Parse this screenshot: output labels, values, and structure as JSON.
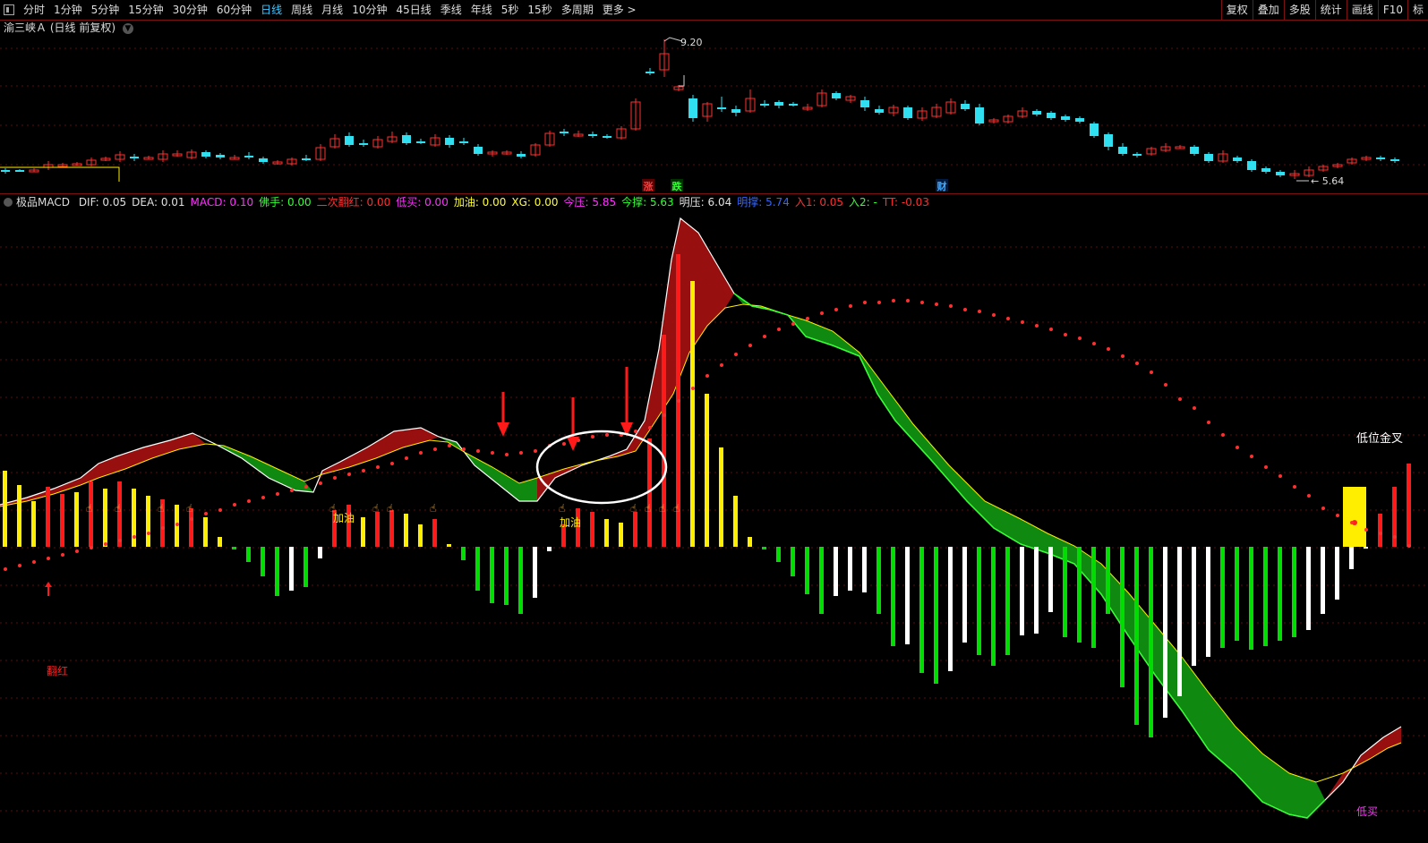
{
  "toolbar": {
    "periods": [
      "分时",
      "1分钟",
      "5分钟",
      "15分钟",
      "30分钟",
      "60分钟",
      "日线",
      "周线",
      "月线",
      "10分钟",
      "45日线",
      "季线",
      "年线",
      "5秒",
      "15秒",
      "多周期",
      "更多 >"
    ],
    "active_index": 6,
    "right_buttons": [
      "复权",
      "叠加",
      "多股",
      "统计",
      "画线",
      "F10",
      "标"
    ]
  },
  "stock": {
    "name": "渝三峡Ａ",
    "mode": "(日线 前复权)"
  },
  "price_chart": {
    "high_label": "9.20",
    "low_label": "5.64",
    "markers": [
      {
        "text": "涨",
        "color": "#ff3b3b",
        "bg": "#5a0000"
      },
      {
        "text": "跌",
        "color": "#33ff33",
        "bg": "#003300"
      },
      {
        "text": "财",
        "color": "#3fa9ff",
        "bg": "#001a40"
      }
    ],
    "colors": {
      "up": "#ff3030",
      "down": "#30e0f0",
      "grid": "#5a0c0c"
    }
  },
  "indicator": {
    "name": "极品MACD",
    "legend": [
      {
        "label": "DIF:",
        "value": "0.05",
        "color": "#e0e0e0"
      },
      {
        "label": "DEA:",
        "value": "0.01",
        "color": "#e0e0e0"
      },
      {
        "label": "MACD:",
        "value": "0.10",
        "color": "#ff33ff"
      },
      {
        "label": "佛手:",
        "value": "0.00",
        "color": "#33ff33"
      },
      {
        "label": "二次翻红:",
        "value": "0.00",
        "color": "#ff3030"
      },
      {
        "label": "低买:",
        "value": "0.00",
        "color": "#ff33ff"
      },
      {
        "label": "加油:",
        "value": "0.00",
        "color": "#ffff33"
      },
      {
        "label": "XG:",
        "value": "0.00",
        "color": "#ffff33"
      },
      {
        "label": "今压:",
        "value": "5.85",
        "color": "#ff33ff"
      },
      {
        "label": "今撑:",
        "value": "5.63",
        "color": "#33ff33"
      },
      {
        "label": "明压:",
        "value": "6.04",
        "color": "#e0e0e0"
      },
      {
        "label": "明撑:",
        "value": "5.74",
        "color": "#3366ff"
      },
      {
        "label": "入1:",
        "value": "0.05",
        "color": "#ff3030"
      },
      {
        "label": "入2:",
        "value": "-",
        "color": "#33ff33"
      },
      {
        "label": "TT:",
        "value": "-0.03",
        "color": "#ff3030"
      }
    ],
    "annotations": {
      "fanhong": "翻红",
      "jiayou1": "加油",
      "jiayou2": "加油",
      "diwei_jincha": "低位金叉",
      "dimai": "低买"
    },
    "colors": {
      "red": "#ff1a1a",
      "yellow": "#ffee00",
      "green": "#00dd00",
      "white": "#ffffff",
      "band_red": "#a01010",
      "band_green": "#109010"
    }
  }
}
